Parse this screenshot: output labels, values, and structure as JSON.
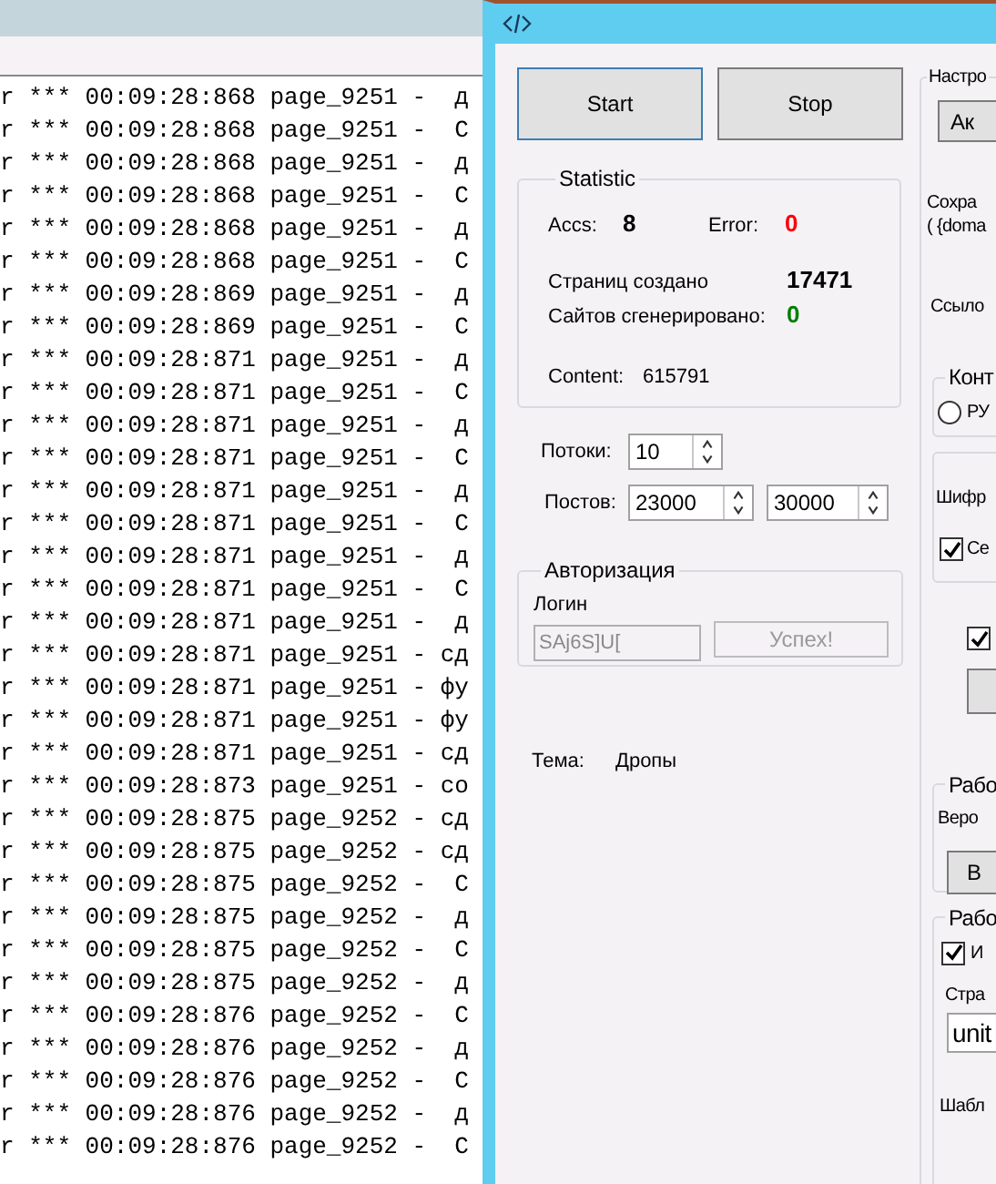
{
  "log": {
    "rows": [
      {
        "text": "r *** 00:09:28:868 page_9251 -  д"
      },
      {
        "text": "r *** 00:09:28:868 page_9251 -  С"
      },
      {
        "text": "r *** 00:09:28:868 page_9251 -  д"
      },
      {
        "text": "r *** 00:09:28:868 page_9251 -  С"
      },
      {
        "text": "r *** 00:09:28:868 page_9251 -  д"
      },
      {
        "text": "r *** 00:09:28:868 page_9251 -  С"
      },
      {
        "text": "r *** 00:09:28:869 page_9251 -  д"
      },
      {
        "text": "r *** 00:09:28:869 page_9251 -  С"
      },
      {
        "text": "r *** 00:09:28:871 page_9251 -  д"
      },
      {
        "text": "r *** 00:09:28:871 page_9251 -  С"
      },
      {
        "text": "r *** 00:09:28:871 page_9251 -  д"
      },
      {
        "text": "r *** 00:09:28:871 page_9251 -  С"
      },
      {
        "text": "r *** 00:09:28:871 page_9251 -  д"
      },
      {
        "text": "r *** 00:09:28:871 page_9251 -  С"
      },
      {
        "text": "r *** 00:09:28:871 page_9251 -  д"
      },
      {
        "text": "r *** 00:09:28:871 page_9251 -  С"
      },
      {
        "text": "r *** 00:09:28:871 page_9251 -  д"
      },
      {
        "text": "r *** 00:09:28:871 page_9251 - сд"
      },
      {
        "text": "r *** 00:09:28:871 page_9251 - фу"
      },
      {
        "text": "r *** 00:09:28:871 page_9251 - фу"
      },
      {
        "text": "r *** 00:09:28:871 page_9251 - сд"
      },
      {
        "text": "r *** 00:09:28:873 page_9251 - со"
      },
      {
        "text": "r *** 00:09:28:875 page_9252 - сд"
      },
      {
        "text": "r *** 00:09:28:875 page_9252 - сд"
      },
      {
        "text": "r *** 00:09:28:875 page_9252 -  С"
      },
      {
        "text": "r *** 00:09:28:875 page_9252 -  д"
      },
      {
        "text": "r *** 00:09:28:875 page_9252 -  С"
      },
      {
        "text": "r *** 00:09:28:875 page_9252 -  д"
      },
      {
        "text": "r *** 00:09:28:876 page_9252 -  С"
      },
      {
        "text": "r *** 00:09:28:876 page_9252 -  д"
      },
      {
        "text": "r *** 00:09:28:876 page_9252 -  С"
      },
      {
        "text": "r *** 00:09:28:876 page_9252 -  д"
      },
      {
        "text": "r *** 00:09:28:876 page_9252 -  С"
      }
    ]
  },
  "window": {
    "buttons": [
      {
        "label": "Start",
        "focused": true
      },
      {
        "label": "Stop",
        "focused": false
      }
    ],
    "statistic": {
      "title": "Statistic",
      "accs": {
        "label": "Accs:",
        "value": "8",
        "color": "#000000"
      },
      "error": {
        "label": "Error:",
        "value": "0",
        "color": "#ff0000"
      },
      "pages": {
        "label": "Страниц создано",
        "value": "17471",
        "color": "#000000"
      },
      "sites": {
        "label": "Сайтов сгенерировано:",
        "value": "0",
        "color": "#008000"
      },
      "content": {
        "label": "Content:",
        "value": "615791"
      }
    },
    "threads": {
      "label": "Потоки:",
      "value": "10"
    },
    "posts": {
      "label": "Постов:",
      "min": "23000",
      "max": "30000"
    },
    "auth": {
      "title": "Авторизация",
      "login_label": "Логин",
      "login_value": "SAj6S]U[",
      "login_disabled": true,
      "button": "Успех!",
      "button_disabled": true
    },
    "theme": {
      "label": "Тема:",
      "value": "Дропы"
    },
    "right_panel": {
      "title": "Настро",
      "action_button": "Ак",
      "save_lines": [
        "Сохра",
        "( {doma"
      ],
      "links_label": "Ссыло",
      "contact_group": {
        "title": "Конт",
        "radio": {
          "label": "РУ",
          "selected": false
        }
      },
      "cipher_group": {
        "label": "Шифр",
        "checkbox": {
          "label": "Се",
          "checked": true
        }
      },
      "extra_checkbox": {
        "checked": true
      },
      "work_group_1": {
        "title": "Рабо",
        "label": "Веро",
        "button": "В"
      },
      "work_group_2": {
        "title": "Рабо",
        "checkbox": {
          "label": "И",
          "checked": true
        },
        "label": "Стра",
        "field_value": "unit",
        "footer_label": "Шабл"
      }
    }
  }
}
